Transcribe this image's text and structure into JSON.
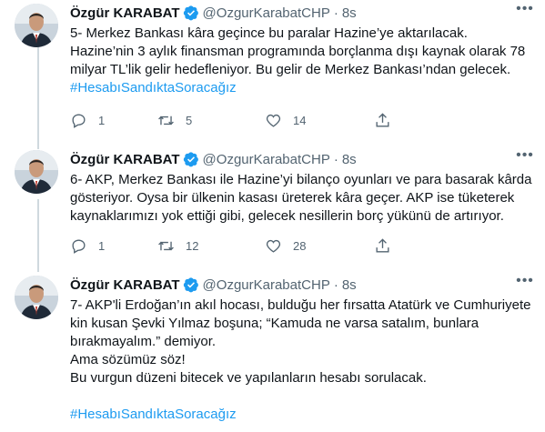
{
  "colors": {
    "accent": "#1d9bf0",
    "secondary_text": "#536471",
    "thread_line": "#cfd9de"
  },
  "icons": [
    "verified-badge-icon",
    "more-icon",
    "reply-icon",
    "retweet-icon",
    "like-icon",
    "share-icon"
  ],
  "tweets": [
    {
      "author": {
        "name": "Özgür KARABAT",
        "handle": "@OzgurKarabatCHP",
        "time": "8s"
      },
      "text": "5- Merkez Bankası kâra geçince bu paralar Hazine’ye aktarılacak.\nHazine’nin 3 aylık finansman programında borçlanma dışı kaynak olarak 78 milyar TL’lik gelir hedefleniyor. Bu gelir de Merkez Bankası’ndan gelecek.",
      "hashtag": "#HesabıSandıktaSoracağız",
      "stats": {
        "replies": "1",
        "retweets": "5",
        "likes": "14"
      }
    },
    {
      "author": {
        "name": "Özgür KARABAT",
        "handle": "@OzgurKarabatCHP",
        "time": "8s"
      },
      "text": "6- AKP, Merkez Bankası ile Hazine’yi bilanço oyunları ve para basarak kârda gösteriyor. Oysa bir ülkenin kasası üreterek kâra geçer. AKP ise tüketerek kaynaklarımızı yok ettiği gibi, gelecek nesillerin borç yükünü de artırıyor.",
      "hashtag": "",
      "stats": {
        "replies": "1",
        "retweets": "12",
        "likes": "28"
      }
    },
    {
      "author": {
        "name": "Özgür KARABAT",
        "handle": "@OzgurKarabatCHP",
        "time": "8s"
      },
      "text": "7- AKP'li Erdoğan’ın akıl hocası, bulduğu her fırsatta Atatürk ve Cumhuriyete kin kusan Şevki Yılmaz boşuna; “Kamuda ne varsa satalım, bunlara bırakmayalım.” demiyor.\nAma sözümüz söz!\nBu vurgun düzeni bitecek ve yapılanların hesabı sorulacak.\n",
      "hashtag": "#HesabıSandıktaSoracağız",
      "stats": null
    }
  ]
}
